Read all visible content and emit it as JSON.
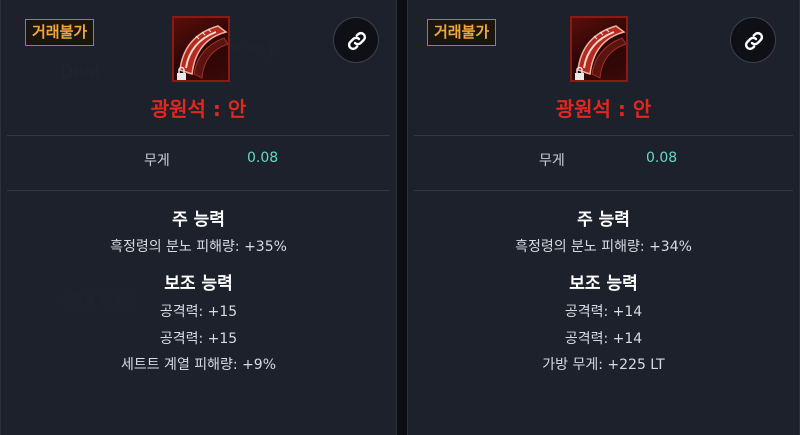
{
  "panels": [
    {
      "trade_badge": "거래불가",
      "item_name": "광원석 : 안",
      "weight_label": "무게",
      "weight_value": "0.08",
      "main_title": "주 능력",
      "main_stats": [
        "흑정령의 분노 피해량: +35%"
      ],
      "sub_title": "보조 능력",
      "sub_stats": [
        "공격력: +15",
        "공격력: +15",
        "세트트 계열 피해량: +9%"
      ]
    },
    {
      "trade_badge": "거래불가",
      "item_name": "광원석 : 안",
      "weight_label": "무게",
      "weight_value": "0.08",
      "main_title": "주 능력",
      "main_stats": [
        "흑정령의 분노 피해량: +34%"
      ],
      "sub_title": "보조 능력",
      "sub_stats": [
        "공격력: +14",
        "공격력: +14",
        "가방 무게: +225 LT"
      ]
    }
  ],
  "icons": {
    "item": "red-crystal-shard-icon",
    "lock": "lock-icon",
    "link": "link-icon"
  },
  "colors": {
    "item_name": "#e2271f",
    "weight_value": "#65d8c8",
    "trade_badge": "#f2a63a"
  }
}
